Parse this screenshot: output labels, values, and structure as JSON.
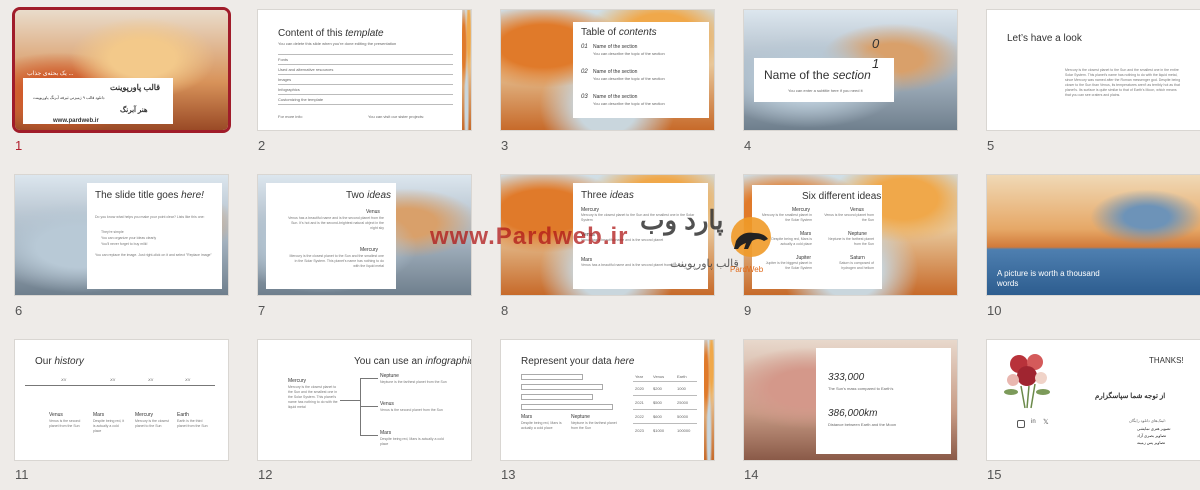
{
  "slides": [
    {
      "num": "1",
      "title_fa": "قالب پاورپوینت",
      "sub_fa": "هنر آبرنگ",
      "desc_fa": "دانلود قالب ۹ ژمیزتی ئیرفه آبرنگ پاورپوینت",
      "top_fa": "یک بحثه‌ی جذاب ...",
      "site": "www.pardweb.ir"
    },
    {
      "num": "2",
      "title": "Content of this",
      "title_it": "template",
      "intro": "You can delete this slide when you're done editing the presentation",
      "rows": [
        "Fonts",
        "Used and alternative resources",
        "Images",
        "Infographics",
        "Customizing the template"
      ],
      "foot1": "For more info:",
      "foot2": "You can visit our sister projects:"
    },
    {
      "num": "3",
      "title": "Table of",
      "title_it": "contents",
      "items": [
        {
          "n": "01",
          "name": "Name of the section",
          "desc": "You can describe the topic of the section"
        },
        {
          "n": "02",
          "name": "Name of the section",
          "desc": "You can describe the topic of the section"
        },
        {
          "n": "03",
          "name": "Name of the section",
          "desc": "You can describe the topic of the section"
        }
      ]
    },
    {
      "num": "4",
      "big_num1": "0",
      "big_num2": "1",
      "title": "Name of the",
      "title_it": "section",
      "subtitle": "You can enter a subtitle here if you need it"
    },
    {
      "num": "5",
      "title": "Let’s have a look",
      "body": "Mercury is the closest planet to the Sun and the smallest one in the entire Solar System. This planet's name has nothing to do with the liquid metal, since Mercury was named after the Roman messenger god. Despite being closer to the Sun than Venus, its temperatures aren't as terribly hot as that planet's. Its surface is quite similar to that of Earth's Moon, which means that you can see craters and plains."
    },
    {
      "num": "6",
      "title": "The slide title goes",
      "title_it": "here!",
      "q": "Do you know what helps you make your point clear? Lists like this one:",
      "bullets": [
        "They're simple",
        "You can organize your ideas clearly",
        "You'll never forget to buy milk!"
      ],
      "after": "You can replace the image. Just right-click on it and select \"Replace image\""
    },
    {
      "num": "7",
      "title": "Two",
      "title_it": "ideas",
      "h1": "Venus",
      "p1": "Venus has a beautiful name and is the second planet from the Sun. It's hot and is the second-brightest natural object in the night sky",
      "h2": "Mercury",
      "p2": "Mercury is the closest planet to the Sun and the smallest one in the Solar System. This planet's name has nothing to do with the liquid metal"
    },
    {
      "num": "8",
      "title": "Three",
      "title_it": "ideas",
      "ideas": [
        {
          "h": "Mercury",
          "p": "Mercury is the closest planet to the Sun and the smallest one in the Solar System"
        },
        {
          "h": "Venus",
          "p": "Venus has a beautiful name and is the second planet"
        },
        {
          "h": "Mars",
          "p": "Venus has a beautiful name and is the second planet from the Sun"
        }
      ]
    },
    {
      "num": "9",
      "title": "Six different ideas",
      "ideas": [
        {
          "h": "Mercury",
          "p": "Mercury is the smallest planet in the Solar System"
        },
        {
          "h": "Venus",
          "p": "Venus is the second planet from the Sun"
        },
        {
          "h": "Mars",
          "p": "Despite being red, Mars is actually a cold place"
        },
        {
          "h": "Neptune",
          "p": "Neptune is the farthest planet from the Sun"
        },
        {
          "h": "Jupiter",
          "p": "Jupiter is the biggest planet in the Solar System"
        },
        {
          "h": "Saturn",
          "p": "Saturn is composed of hydrogen and helium"
        }
      ]
    },
    {
      "num": "10",
      "caption": "A picture is worth a thousand words"
    },
    {
      "num": "11",
      "title": "Our",
      "title_it": "history",
      "marks": [
        "XX",
        "XX",
        "XX",
        "XX"
      ],
      "items": [
        {
          "h": "Venus",
          "p": "Venus is the second planet from the Sun"
        },
        {
          "h": "Mars",
          "p": "Despite being red, it is actually a cold place"
        },
        {
          "h": "Mercury",
          "p": "Mercury is the closest planet to the Sun"
        },
        {
          "h": "Earth",
          "p": "Earth is the third planet from the Sun"
        }
      ]
    },
    {
      "num": "12",
      "title": "You can use an",
      "title_it": "infographic",
      "left_h": "Mercury",
      "left_p": "Mercury is the closest planet to the Sun and the smallest one in the Solar System. This planet's name has nothing to do with the liquid metal",
      "right": [
        {
          "h": "Neptune",
          "p": "Neptune is the farthest planet from the Sun"
        },
        {
          "h": "Venus",
          "p": "Venus is the second planet from the Sun"
        },
        {
          "h": "Mars",
          "p": "Despite being red, Mars is actually a cold place"
        }
      ]
    },
    {
      "num": "13",
      "title": "Represent your data",
      "title_it": "here",
      "cols": [
        "Year",
        "Venus",
        "Earth"
      ],
      "rows": [
        [
          "2020",
          "$200",
          "1000"
        ],
        [
          "2021",
          "$500",
          "25000"
        ],
        [
          "2022",
          "$600",
          "50000"
        ],
        [
          "2023",
          "$1000",
          "100000"
        ]
      ],
      "h1": "Mars",
      "p1": "Despite being red, Mars is actually a cold place",
      "h2": "Neptune",
      "p2": "Neptune is the farthest planet from the Sun"
    },
    {
      "num": "14",
      "v1": "333,000",
      "d1": "The Sun's mass compared to Earth's",
      "v2": "386,000km",
      "d2": "Distance between Earth and the Moon"
    },
    {
      "num": "15",
      "thanks": "THANKS!",
      "fa": "از توجه شما سپاسگزارم",
      "contact_fa": "لینک‌های دانلود رایگان:",
      "links": [
        "تصویر هنری نمایشی",
        "تصاویر بصری آزاد",
        "تصاویر پس زمینه"
      ]
    }
  ],
  "watermark": {
    "brand_fa": "پارد وب",
    "brand_en": "PardWeb",
    "site": "www.Pardweb.ir",
    "slogan_fa": "قالب پاورپوینت"
  },
  "colors": {
    "selected": "#a01c2a",
    "accent": "#e06a1a"
  }
}
